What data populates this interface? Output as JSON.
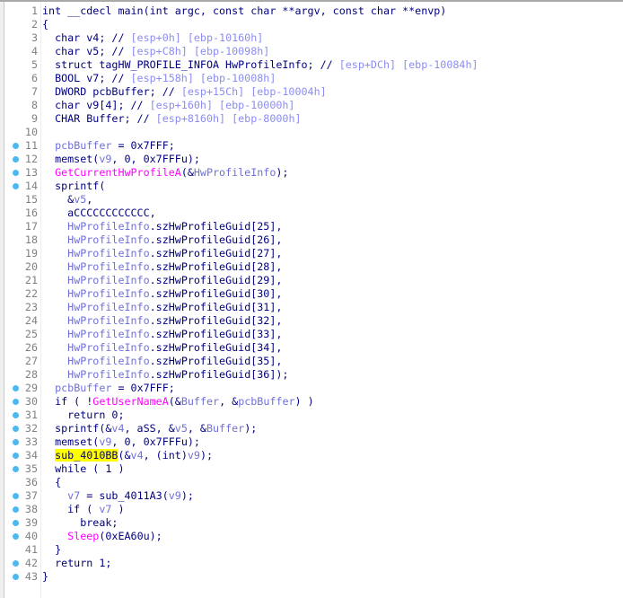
{
  "colors": {
    "keyword": "#000080",
    "variable": "#7070d8",
    "comment": "#8c8cf4",
    "import": "#ff00ff",
    "highlight": "#ffff00",
    "breakpoint_dot": "#4cb8f0"
  },
  "lines": [
    {
      "n": "1",
      "dot": false,
      "t": [
        [
          "k",
          "int __cdecl main(int argc, const char **argv, const char **envp)"
        ]
      ]
    },
    {
      "n": "2",
      "dot": false,
      "t": [
        [
          "k",
          "{"
        ]
      ]
    },
    {
      "n": "3",
      "dot": false,
      "t": [
        [
          "k",
          "  char v4; // "
        ],
        [
          "c",
          "[esp+0h] [ebp-10160h]"
        ]
      ]
    },
    {
      "n": "4",
      "dot": false,
      "t": [
        [
          "k",
          "  char v5; // "
        ],
        [
          "c",
          "[esp+C8h] [ebp-10098h]"
        ]
      ]
    },
    {
      "n": "5",
      "dot": false,
      "t": [
        [
          "k",
          "  struct tagHW_PROFILE_INFOA HwProfileInfo; // "
        ],
        [
          "c",
          "[esp+DCh] [ebp-10084h]"
        ]
      ]
    },
    {
      "n": "6",
      "dot": false,
      "t": [
        [
          "k",
          "  BOOL v7; // "
        ],
        [
          "c",
          "[esp+158h] [ebp-10008h]"
        ]
      ]
    },
    {
      "n": "7",
      "dot": false,
      "t": [
        [
          "k",
          "  DWORD pcbBuffer; // "
        ],
        [
          "c",
          "[esp+15Ch] [ebp-10004h]"
        ]
      ]
    },
    {
      "n": "8",
      "dot": false,
      "t": [
        [
          "k",
          "  char v9[4]; // "
        ],
        [
          "c",
          "[esp+160h] [ebp-10000h]"
        ]
      ]
    },
    {
      "n": "9",
      "dot": false,
      "t": [
        [
          "k",
          "  CHAR Buffer; // "
        ],
        [
          "c",
          "[esp+8160h] [ebp-8000h]"
        ]
      ]
    },
    {
      "n": "10",
      "dot": false,
      "t": []
    },
    {
      "n": "11",
      "dot": true,
      "t": [
        [
          "k",
          "  "
        ],
        [
          "v",
          "pcbBuffer"
        ],
        [
          "k",
          " = 0x7FFF;"
        ]
      ]
    },
    {
      "n": "12",
      "dot": true,
      "t": [
        [
          "k",
          "  memset("
        ],
        [
          "v",
          "v9"
        ],
        [
          "k",
          ", 0, 0x7FFFu);"
        ]
      ]
    },
    {
      "n": "13",
      "dot": true,
      "t": [
        [
          "k",
          "  "
        ],
        [
          "f",
          "GetCurrentHwProfileA"
        ],
        [
          "k",
          "(&"
        ],
        [
          "v",
          "HwProfileInfo"
        ],
        [
          "k",
          ");"
        ]
      ]
    },
    {
      "n": "14",
      "dot": true,
      "t": [
        [
          "k",
          "  sprintf("
        ]
      ]
    },
    {
      "n": "15",
      "dot": false,
      "t": [
        [
          "k",
          "    &"
        ],
        [
          "v",
          "v5"
        ],
        [
          "k",
          ","
        ]
      ]
    },
    {
      "n": "16",
      "dot": false,
      "t": [
        [
          "k",
          "    aCCCCCCCCCCCC,"
        ]
      ]
    },
    {
      "n": "17",
      "dot": false,
      "t": [
        [
          "k",
          "    "
        ],
        [
          "v",
          "HwProfileInfo"
        ],
        [
          "k",
          ".szHwProfileGuid[25],"
        ]
      ]
    },
    {
      "n": "18",
      "dot": false,
      "t": [
        [
          "k",
          "    "
        ],
        [
          "v",
          "HwProfileInfo"
        ],
        [
          "k",
          ".szHwProfileGuid[26],"
        ]
      ]
    },
    {
      "n": "19",
      "dot": false,
      "t": [
        [
          "k",
          "    "
        ],
        [
          "v",
          "HwProfileInfo"
        ],
        [
          "k",
          ".szHwProfileGuid[27],"
        ]
      ]
    },
    {
      "n": "20",
      "dot": false,
      "t": [
        [
          "k",
          "    "
        ],
        [
          "v",
          "HwProfileInfo"
        ],
        [
          "k",
          ".szHwProfileGuid[28],"
        ]
      ]
    },
    {
      "n": "21",
      "dot": false,
      "t": [
        [
          "k",
          "    "
        ],
        [
          "v",
          "HwProfileInfo"
        ],
        [
          "k",
          ".szHwProfileGuid[29],"
        ]
      ]
    },
    {
      "n": "22",
      "dot": false,
      "t": [
        [
          "k",
          "    "
        ],
        [
          "v",
          "HwProfileInfo"
        ],
        [
          "k",
          ".szHwProfileGuid[30],"
        ]
      ]
    },
    {
      "n": "23",
      "dot": false,
      "t": [
        [
          "k",
          "    "
        ],
        [
          "v",
          "HwProfileInfo"
        ],
        [
          "k",
          ".szHwProfileGuid[31],"
        ]
      ]
    },
    {
      "n": "24",
      "dot": false,
      "t": [
        [
          "k",
          "    "
        ],
        [
          "v",
          "HwProfileInfo"
        ],
        [
          "k",
          ".szHwProfileGuid[32],"
        ]
      ]
    },
    {
      "n": "25",
      "dot": false,
      "t": [
        [
          "k",
          "    "
        ],
        [
          "v",
          "HwProfileInfo"
        ],
        [
          "k",
          ".szHwProfileGuid[33],"
        ]
      ]
    },
    {
      "n": "26",
      "dot": false,
      "t": [
        [
          "k",
          "    "
        ],
        [
          "v",
          "HwProfileInfo"
        ],
        [
          "k",
          ".szHwProfileGuid[34],"
        ]
      ]
    },
    {
      "n": "27",
      "dot": false,
      "t": [
        [
          "k",
          "    "
        ],
        [
          "v",
          "HwProfileInfo"
        ],
        [
          "k",
          ".szHwProfileGuid[35],"
        ]
      ]
    },
    {
      "n": "28",
      "dot": false,
      "t": [
        [
          "k",
          "    "
        ],
        [
          "v",
          "HwProfileInfo"
        ],
        [
          "k",
          ".szHwProfileGuid[36]);"
        ]
      ]
    },
    {
      "n": "29",
      "dot": true,
      "t": [
        [
          "k",
          "  "
        ],
        [
          "v",
          "pcbBuffer"
        ],
        [
          "k",
          " = 0x7FFF;"
        ]
      ]
    },
    {
      "n": "30",
      "dot": true,
      "t": [
        [
          "k",
          "  if ( !"
        ],
        [
          "f",
          "GetUserNameA"
        ],
        [
          "k",
          "(&"
        ],
        [
          "v",
          "Buffer"
        ],
        [
          "k",
          ", &"
        ],
        [
          "v",
          "pcbBuffer"
        ],
        [
          "k",
          ") )"
        ]
      ]
    },
    {
      "n": "31",
      "dot": true,
      "t": [
        [
          "k",
          "    return 0;"
        ]
      ]
    },
    {
      "n": "32",
      "dot": true,
      "t": [
        [
          "k",
          "  sprintf(&"
        ],
        [
          "v",
          "v4"
        ],
        [
          "k",
          ", aSS, &"
        ],
        [
          "v",
          "v5"
        ],
        [
          "k",
          ", &"
        ],
        [
          "v",
          "Buffer"
        ],
        [
          "k",
          ");"
        ]
      ]
    },
    {
      "n": "33",
      "dot": true,
      "t": [
        [
          "k",
          "  memset("
        ],
        [
          "v",
          "v9"
        ],
        [
          "k",
          ", 0, 0x7FFFu);"
        ]
      ]
    },
    {
      "n": "34",
      "dot": true,
      "t": [
        [
          "k",
          "  "
        ],
        [
          "h",
          "sub_4010BB"
        ],
        [
          "k",
          "(&"
        ],
        [
          "v",
          "v4"
        ],
        [
          "k",
          ", (int)"
        ],
        [
          "v",
          "v9"
        ],
        [
          "k",
          ");"
        ]
      ]
    },
    {
      "n": "35",
      "dot": true,
      "t": [
        [
          "k",
          "  while ( 1 )"
        ]
      ]
    },
    {
      "n": "36",
      "dot": false,
      "t": [
        [
          "k",
          "  {"
        ]
      ]
    },
    {
      "n": "37",
      "dot": true,
      "t": [
        [
          "k",
          "    "
        ],
        [
          "v",
          "v7"
        ],
        [
          "k",
          " = sub_4011A3("
        ],
        [
          "v",
          "v9"
        ],
        [
          "k",
          ");"
        ]
      ]
    },
    {
      "n": "38",
      "dot": true,
      "t": [
        [
          "k",
          "    if ( "
        ],
        [
          "v",
          "v7"
        ],
        [
          "k",
          " )"
        ]
      ]
    },
    {
      "n": "39",
      "dot": true,
      "t": [
        [
          "k",
          "      break;"
        ]
      ]
    },
    {
      "n": "40",
      "dot": true,
      "t": [
        [
          "k",
          "    "
        ],
        [
          "f",
          "Sleep"
        ],
        [
          "k",
          "(0xEA60u);"
        ]
      ]
    },
    {
      "n": "41",
      "dot": false,
      "t": [
        [
          "k",
          "  }"
        ]
      ]
    },
    {
      "n": "42",
      "dot": true,
      "t": [
        [
          "k",
          "  return 1;"
        ]
      ]
    },
    {
      "n": "43",
      "dot": true,
      "t": [
        [
          "k",
          "}"
        ]
      ]
    }
  ]
}
